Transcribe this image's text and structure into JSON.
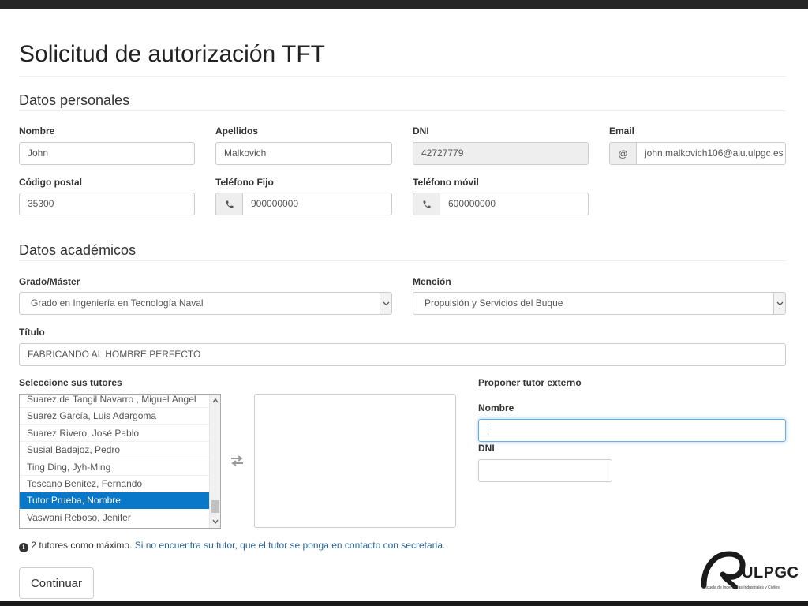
{
  "page": {
    "title": "Solicitud de autorización TFT"
  },
  "personal": {
    "heading": "Datos personales",
    "nombre": {
      "label": "Nombre",
      "value": "John"
    },
    "apellidos": {
      "label": "Apellidos",
      "value": "Malkovich"
    },
    "dni": {
      "label": "DNI",
      "value": "42727779"
    },
    "email": {
      "label": "Email",
      "addon": "@",
      "value": "john.malkovich106@alu.ulpgc.es"
    },
    "codigo_postal": {
      "label": "Código postal",
      "value": "35300"
    },
    "telefono_fijo": {
      "label": "Teléfono Fijo",
      "value": "900000000"
    },
    "telefono_movil": {
      "label": "Teléfono móvil",
      "value": "600000000"
    }
  },
  "academic": {
    "heading": "Datos académicos",
    "grado": {
      "label": "Grado/Máster",
      "value": "Grado en Ingeniería en Tecnología Naval"
    },
    "mencion": {
      "label": "Mención",
      "value": "Propulsión y Servicios del Buque"
    },
    "titulo": {
      "label": "Título",
      "value": "FABRICANDO AL HOMBRE PERFECTO"
    }
  },
  "tutors": {
    "label": "Seleccione sus tutores",
    "items": [
      "Suarez de Tangil Navarro , Miguel Ángel",
      "Suarez García, Luis Adargoma",
      "Suarez Rivero, José Pablo",
      "Susial Badajoz, Pedro",
      "Ting Ding, Jyh-Ming",
      "Toscano Benitez, Fernando",
      "Tutor Prueba, Nombre",
      "Vaswani Reboso, Jenifer"
    ],
    "selected_index": 6
  },
  "external_tutor": {
    "heading": "Proponer tutor externo",
    "nombre": {
      "label": "Nombre",
      "value": "|"
    },
    "dni": {
      "label": "DNI",
      "value": ""
    }
  },
  "note": {
    "icon": "info-icon",
    "text": "2 tutores como máximo.",
    "link": "Si no encuentra su tutor, que el tutor se ponga en contacto con secretaria."
  },
  "actions": {
    "continue": "Continuar"
  },
  "logo": {
    "name": "ULPGC",
    "subtitle": "Escuela de Ingenierías Industriales y Civiles"
  },
  "colors": {
    "selected_row": "#0a78c8",
    "link": "#2a6496",
    "focus_border": "#66afe9"
  }
}
